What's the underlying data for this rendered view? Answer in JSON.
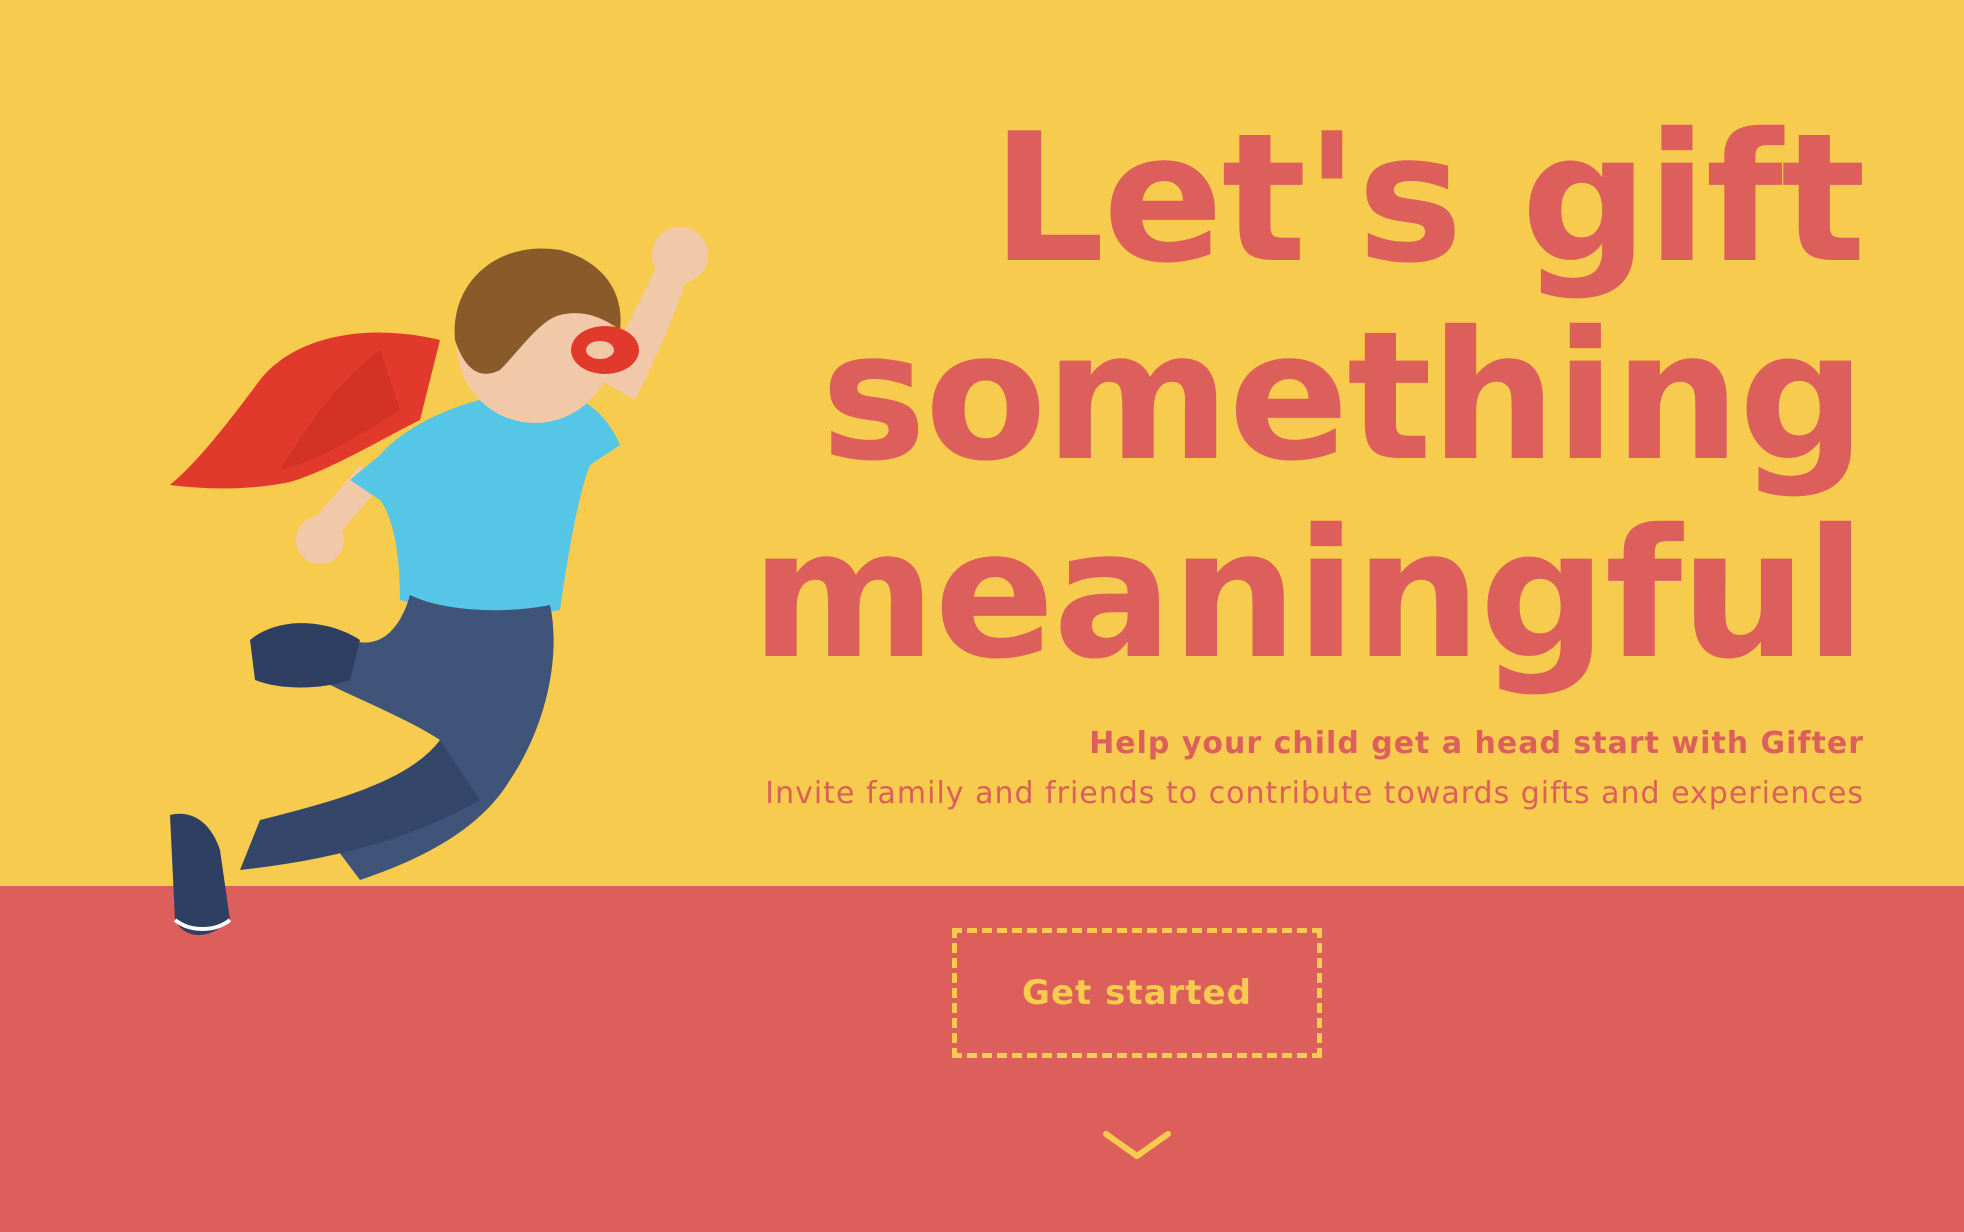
{
  "colors": {
    "yellow": "#f7cb4d",
    "coral": "#dd5f5c",
    "shirt": "#55c6e5",
    "jeans": "#3f5478",
    "cape": "#e13a2c"
  },
  "hero": {
    "headline_lines": [
      "Let's gift",
      "something",
      "meaningful"
    ],
    "subtitle": "Help your child get a head start with Gifter",
    "tagline": "Invite family and friends to contribute towards gifts and experiences",
    "image": "superhero-child-photo"
  },
  "cta": {
    "label": "Get started"
  },
  "scroll": {
    "icon": "chevron-down-icon"
  }
}
